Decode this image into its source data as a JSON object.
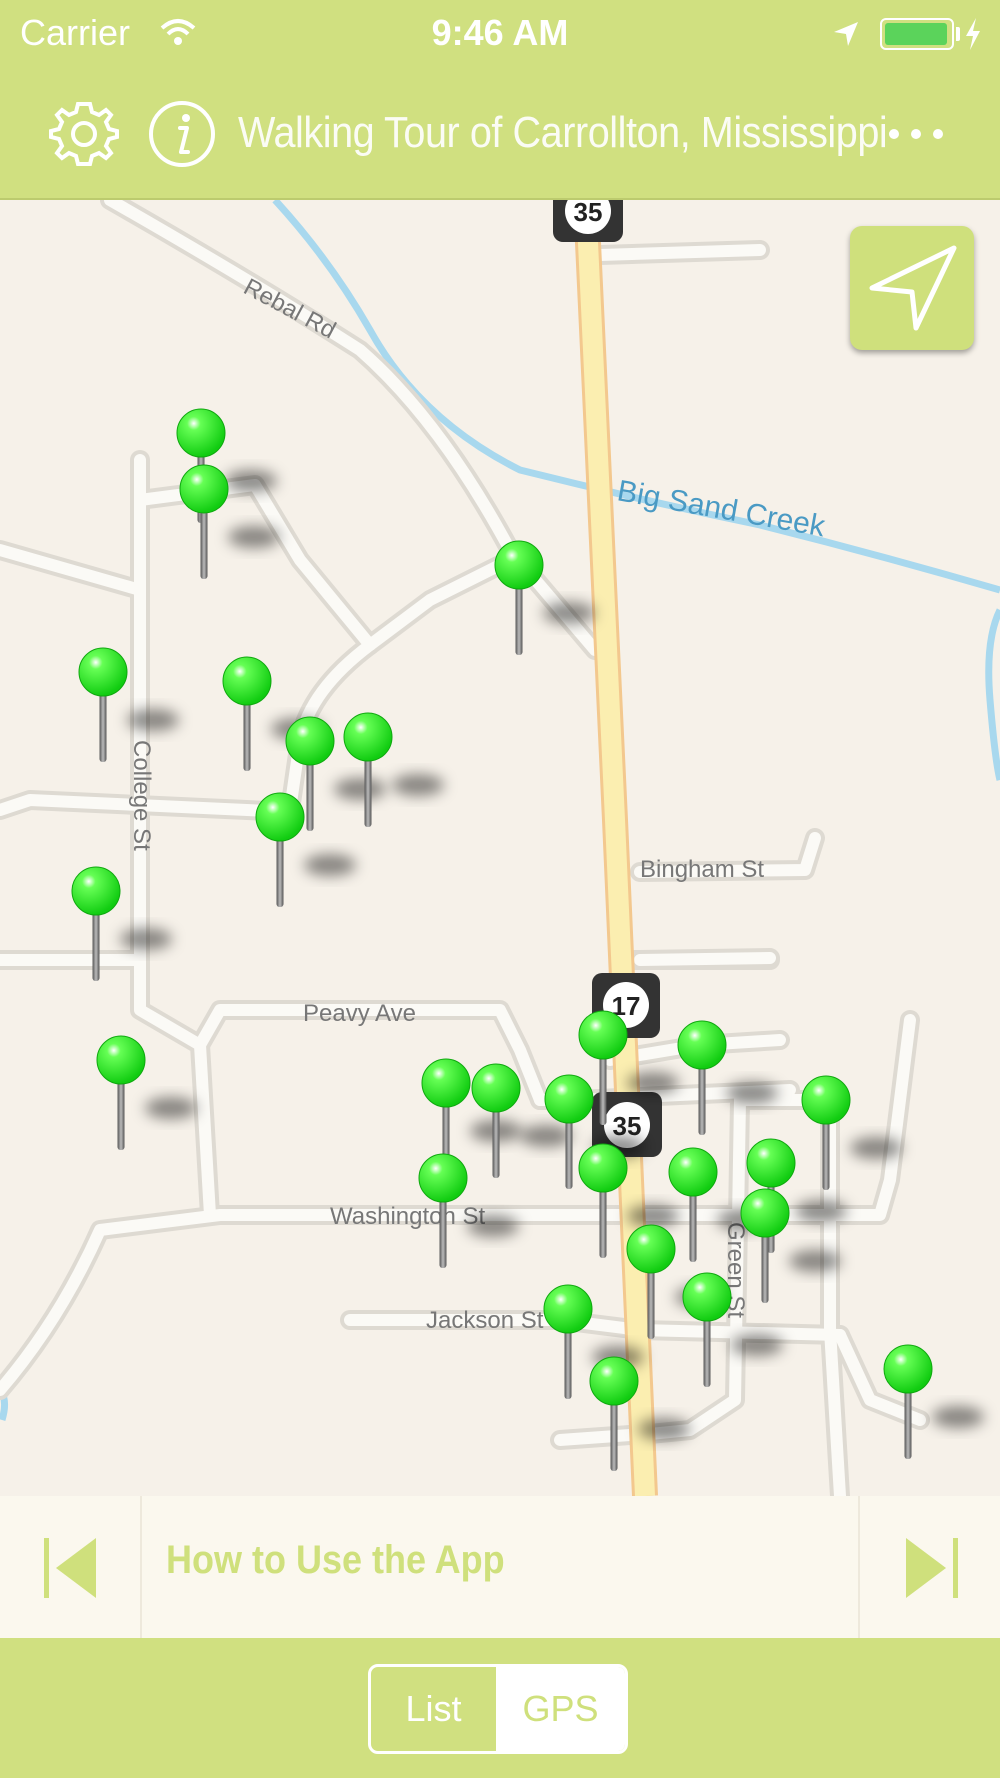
{
  "status_bar": {
    "carrier": "Carrier",
    "time": "9:46 AM",
    "battery_level": 0.85
  },
  "nav_bar": {
    "title": "Walking Tour of Carrollton, Mississippi",
    "settings_icon": "gear-icon",
    "info_icon": "info-icon",
    "more_icon": "more-icon"
  },
  "map": {
    "labels": {
      "rebal": "Rebal Rd",
      "creek": "Big Sand Creek",
      "college": "College St",
      "bingham": "Bingham St",
      "peavy": "Peavy Ave",
      "washington": "Washington St",
      "jackson": "Jackson St",
      "green": "Green St"
    },
    "shields": {
      "top": "35",
      "mid17": "17",
      "mid35": "35"
    },
    "locate_icon": "navigation-arrow-icon"
  },
  "current_item": {
    "title": "How to Use the App",
    "prev_icon": "skip-previous-icon",
    "next_icon": "skip-next-icon"
  },
  "segmented_control": {
    "list_label": "List",
    "gps_label": "GPS",
    "selected": "GPS"
  },
  "colors": {
    "accent": "#d0e080",
    "pin": "#22ee22",
    "map_bg": "#f6f1e9",
    "water": "#a8d8ee",
    "highway": "#fbeeb0"
  }
}
